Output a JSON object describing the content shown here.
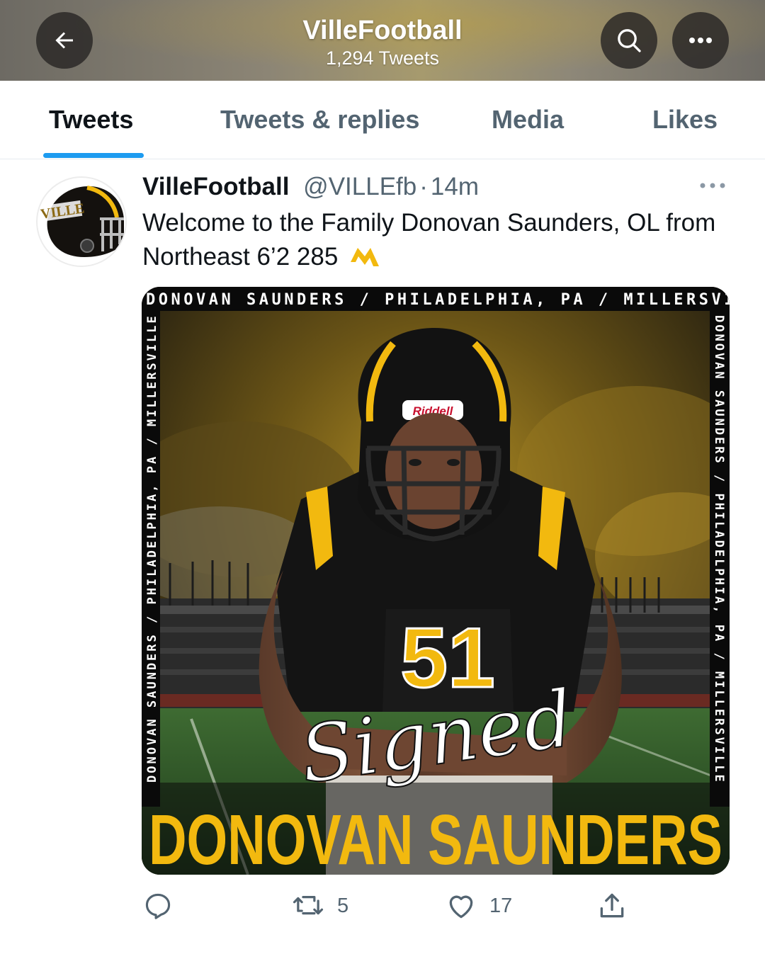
{
  "header": {
    "title": "VilleFootball",
    "subtitle": "1,294 Tweets",
    "back_icon": "arrow-left-icon",
    "search_icon": "search-icon",
    "more_icon": "more-horizontal-icon"
  },
  "tabs": [
    {
      "label": "Tweets",
      "active": true
    },
    {
      "label": "Tweets & replies",
      "active": false
    },
    {
      "label": "Media",
      "active": false
    },
    {
      "label": "Likes",
      "active": false
    }
  ],
  "tweet": {
    "display_name": "VilleFootball",
    "handle": "@VILLEfb",
    "separator": "·",
    "time": "14m",
    "text": "Welcome to the Family Donovan Saunders, OL from Northeast 6’2 285",
    "text_emoji": "millersville-m-icon",
    "avatar": {
      "label": "VILLE"
    },
    "media": {
      "top_banner": "DONOVAN SAUNDERS / PHILADELPHIA, PA / MILLERSVILLE",
      "side_banner": "DONOVAN SAUNDERS / PHILADELPHIA, PA / MILLERSVILLE",
      "helmet_brand": "Riddell",
      "jersey_number": "51",
      "script_word": "Signed",
      "player_name": "DONOVAN SAUNDERS"
    },
    "actions": {
      "reply_count": "",
      "retweet_count": "5",
      "like_count": "17"
    }
  },
  "colors": {
    "accent_blue": "#1d9bf0",
    "gold": "#f2b90f",
    "text_primary": "#0f1419",
    "text_secondary": "#536471"
  }
}
